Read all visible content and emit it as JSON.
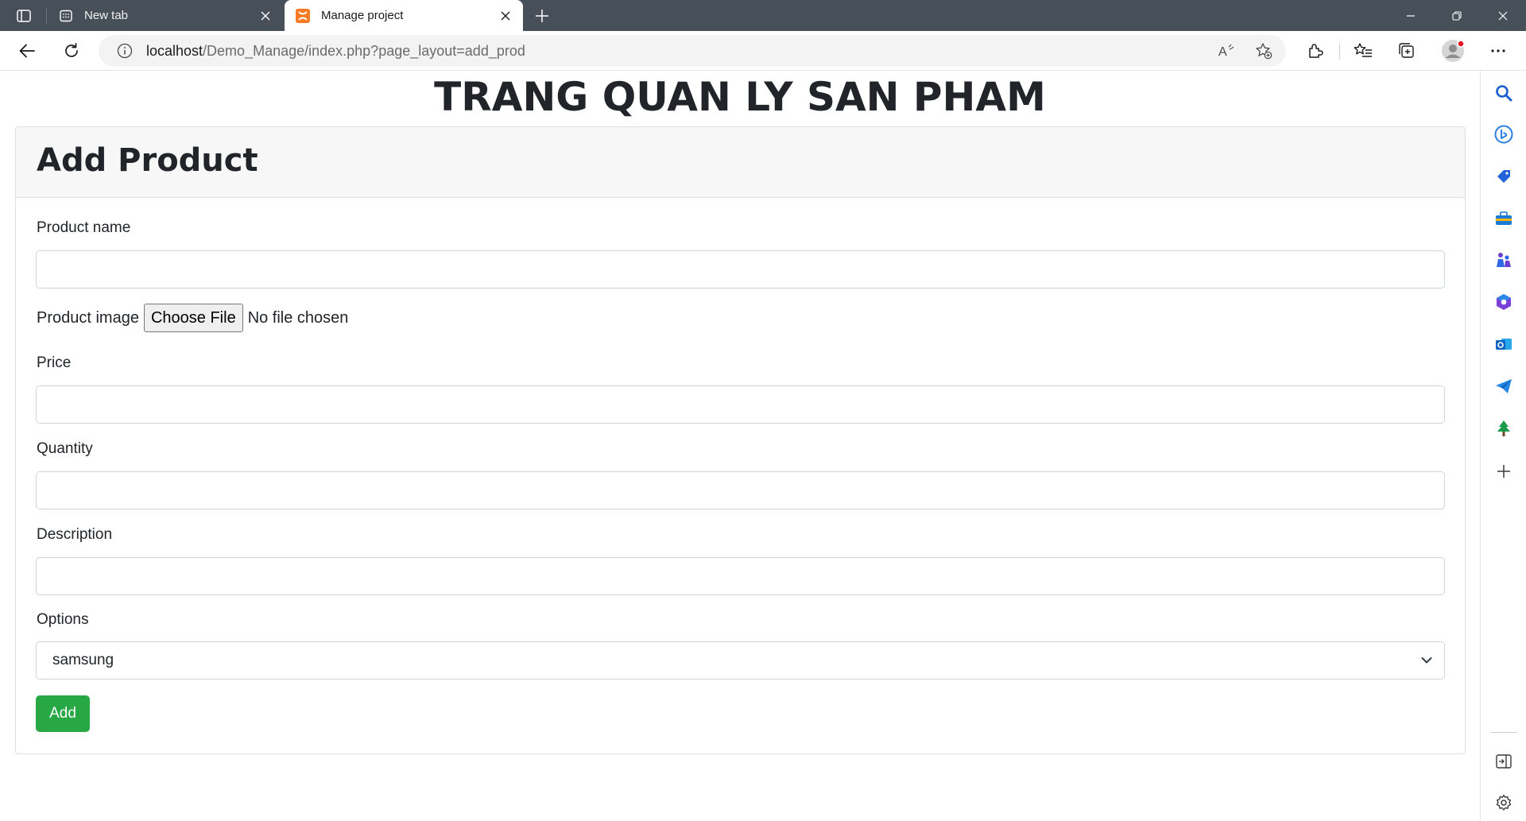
{
  "browser": {
    "tabs": [
      {
        "title": "New tab",
        "active": false,
        "favicon": "new-tab-icon"
      },
      {
        "title": "Manage project",
        "active": true,
        "favicon": "xampp-icon"
      }
    ],
    "address": {
      "host": "localhost",
      "path": "/Demo_Manage/index.php?page_layout=add_prod"
    },
    "accent_color": "#474f59"
  },
  "page": {
    "heading": "TRANG QUAN LY SAN PHAM",
    "card_title": "Add Product",
    "form": {
      "product_name_label": "Product name",
      "product_name_value": "",
      "product_image_label": "Product image",
      "choose_file_label": "Choose File",
      "file_status": "No file chosen",
      "price_label": "Price",
      "price_value": "",
      "quantity_label": "Quantity",
      "quantity_value": "",
      "description_label": "Description",
      "description_value": "",
      "options_label": "Options",
      "options_selected": "samsung",
      "submit_label": "Add",
      "submit_color": "#28a745"
    }
  },
  "sidebar": {
    "icons": [
      "search-icon",
      "bing-chat-icon",
      "shopping-tag-icon",
      "tools-icon",
      "games-icon",
      "microsoft365-icon",
      "outlook-icon",
      "telegram-icon",
      "tree-icon",
      "add-icon",
      "split-screen-icon",
      "settings-icon"
    ]
  }
}
